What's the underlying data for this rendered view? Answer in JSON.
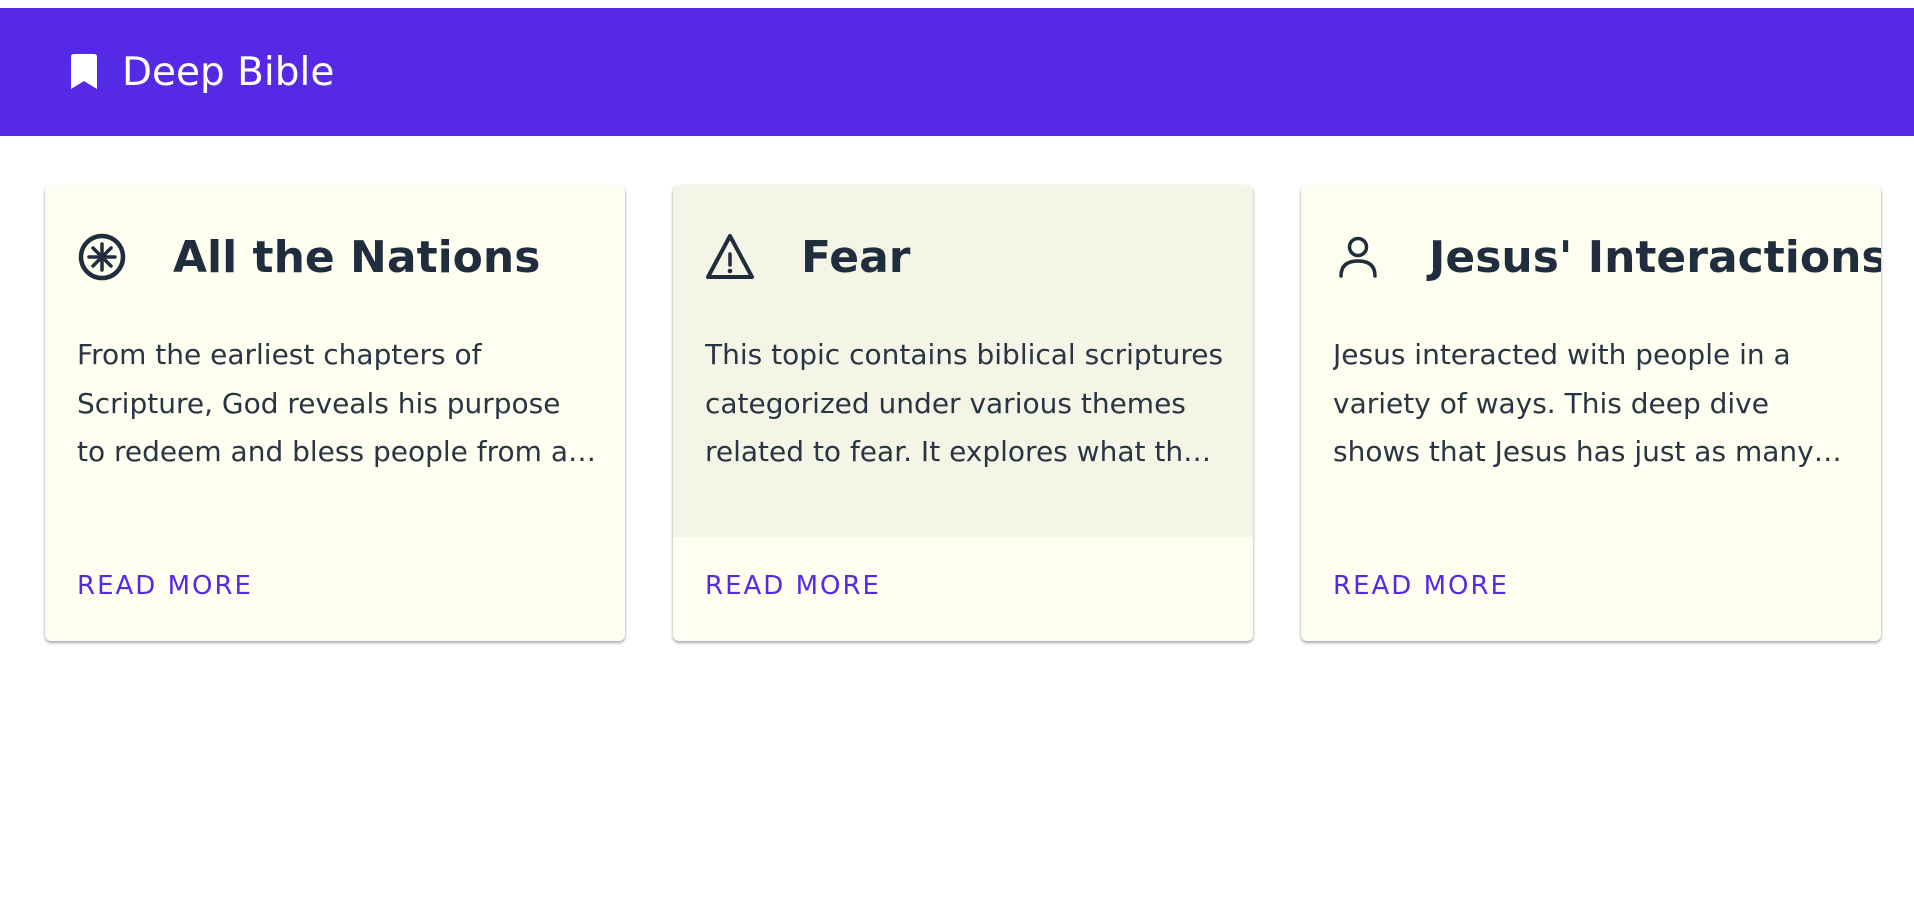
{
  "header": {
    "title": "Deep Bible",
    "icon": "bookmark-icon",
    "background": "#5629e6"
  },
  "cards": [
    {
      "title": "All the Nations",
      "icon": "dharma-wheel-icon",
      "description": "From the earliest chapters of Scripture, God reveals his purpose to redeem and bless people from all nations.",
      "action": "READ MORE",
      "highlighted": false
    },
    {
      "title": "Fear",
      "icon": "warning-triangle-icon",
      "description": "This topic contains biblical scriptures categorized under various themes related to fear. It explores what the Bible says about fear.",
      "action": "READ MORE",
      "highlighted": true
    },
    {
      "title": "Jesus' Interactions",
      "icon": "person-icon",
      "description": "Jesus interacted with people in a variety of ways. This deep dive shows that Jesus has just as many ways of interacting with people.",
      "action": "READ MORE",
      "highlighted": false
    }
  ],
  "colors": {
    "accent": "#5629e6",
    "card_background": "#fefff0",
    "card_hover_background": "#f4f5e7",
    "heading_text": "#1f2d3d"
  }
}
